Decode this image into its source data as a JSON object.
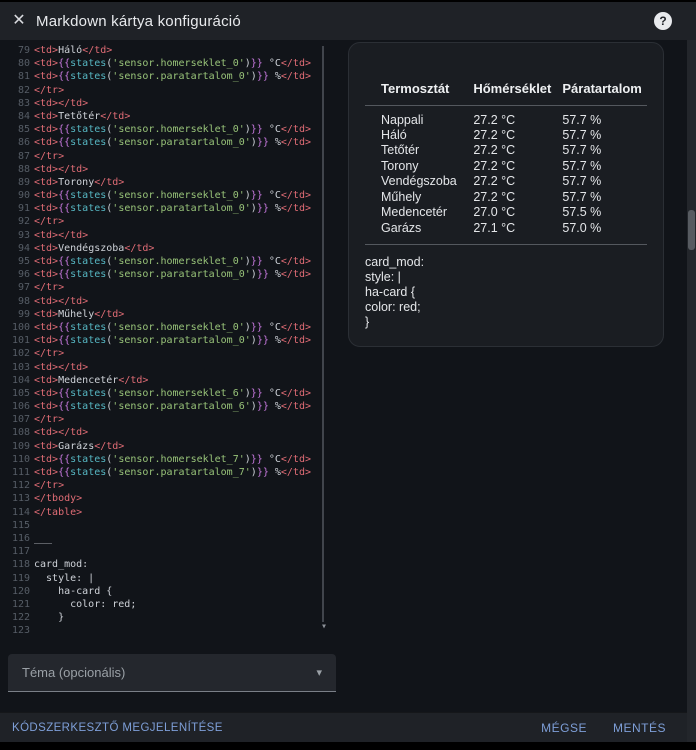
{
  "header": {
    "title": "Markdown kártya konfiguráció"
  },
  "icons": {
    "close": "✕",
    "help": "?",
    "chevron_down": "▾",
    "scroll_down": "▾"
  },
  "editor": {
    "first_line_number": 79,
    "lines": [
      "<td>Háló</td>",
      "<td>{{states('sensor.homerseklet_0')}} °C</td>",
      "<td>{{states('sensor.paratartalom_0')}} %</td>",
      "</tr>",
      "<td></td>",
      "<td>Tetőtér</td>",
      "<td>{{states('sensor.homerseklet_0')}} °C</td>",
      "<td>{{states('sensor.paratartalom_0')}} %</td>",
      "</tr>",
      "<td></td>",
      "<td>Torony</td>",
      "<td>{{states('sensor.homerseklet_0')}} °C</td>",
      "<td>{{states('sensor.paratartalom_0')}} %</td>",
      "</tr>",
      "<td></td>",
      "<td>Vendégszoba</td>",
      "<td>{{states('sensor.homerseklet_0')}} °C</td>",
      "<td>{{states('sensor.paratartalom_0')}} %</td>",
      "</tr>",
      "<td></td>",
      "<td>Műhely</td>",
      "<td>{{states('sensor.homerseklet_0')}} °C</td>",
      "<td>{{states('sensor.paratartalom_0')}} %</td>",
      "</tr>",
      "<td></td>",
      "<td>Medencetér</td>",
      "<td>{{states('sensor.homerseklet_6')}} °C</td>",
      "<td>{{states('sensor.paratartalom_6')}} %</td>",
      "</tr>",
      "<td></td>",
      "<td>Garázs</td>",
      "<td>{{states('sensor.homerseklet_7')}} °C</td>",
      "<td>{{states('sensor.paratartalom_7')}} %</td>",
      "</tr>",
      "</tbody>",
      "</table>",
      "",
      "___",
      "",
      "card_mod:",
      "  style: |",
      "    ha-card {",
      "      color: red;",
      "    }",
      ""
    ]
  },
  "preview": {
    "table": {
      "headers": [
        "Termosztát",
        "Hőmérséklet",
        "Páratartalom"
      ],
      "rows": [
        [
          "Nappali",
          "27.2 °C",
          "57.7 %"
        ],
        [
          "Háló",
          "27.2 °C",
          "57.7 %"
        ],
        [
          "Tetőtér",
          "27.2 °C",
          "57.7 %"
        ],
        [
          "Torony",
          "27.2 °C",
          "57.7 %"
        ],
        [
          "Vendégszoba",
          "27.2 °C",
          "57.7 %"
        ],
        [
          "Műhely",
          "27.2 °C",
          "57.7 %"
        ],
        [
          "Medencetér",
          "27.0 °C",
          "57.5 %"
        ],
        [
          "Garázs",
          "27.1 °C",
          "57.0 %"
        ]
      ]
    },
    "code_lines": [
      "card_mod:",
      "style: |",
      "ha-card {",
      "color: red;",
      "}"
    ]
  },
  "theme_select": {
    "label": "Téma (opcionális)"
  },
  "footer": {
    "toggle_editor": "KÓDSZERKESZTŐ MEGJELENÍTÉSE",
    "cancel": "MÉGSE",
    "save": "MENTÉS"
  },
  "colors": {
    "accent": "#7e9fd8",
    "tag": "#e06c75",
    "brace": "#c678dd",
    "string": "#98c379",
    "function": "#56b6c2"
  }
}
